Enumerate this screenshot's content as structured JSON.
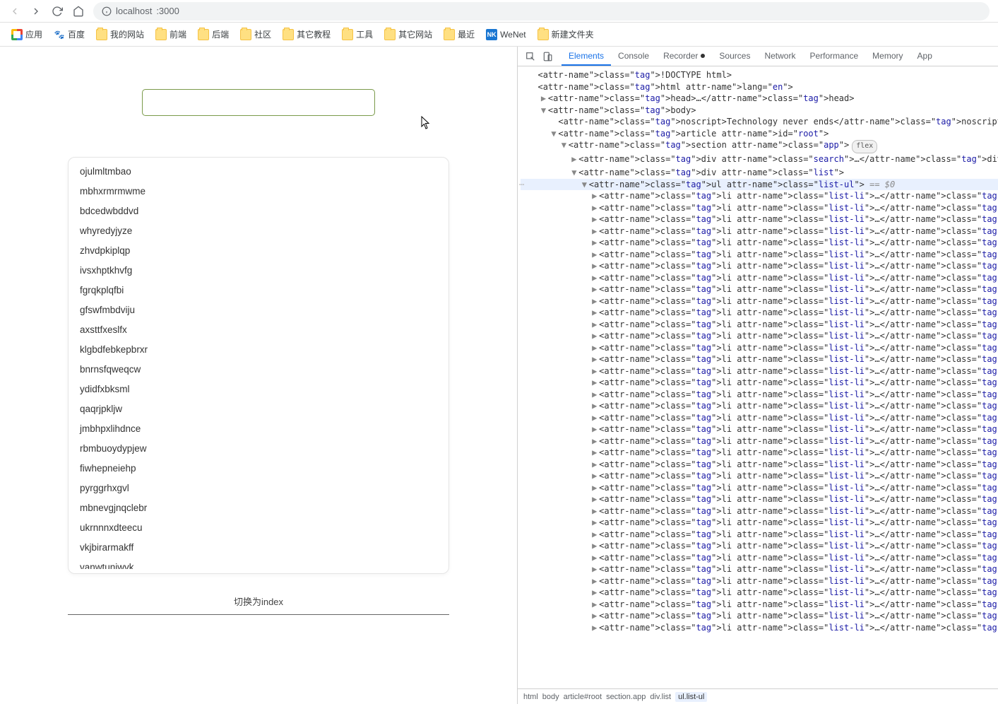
{
  "nav": {
    "url_prefix": "localhost",
    "url_suffix": ":3000"
  },
  "bookmarks": {
    "apps": "应用",
    "baidu": "百度",
    "items": [
      {
        "label": "我的网站"
      },
      {
        "label": "前端"
      },
      {
        "label": "后端"
      },
      {
        "label": "社区"
      },
      {
        "label": "其它教程"
      },
      {
        "label": "工具"
      },
      {
        "label": "其它网站"
      },
      {
        "label": "最近"
      }
    ],
    "wenet": "WeNet",
    "newfolder": "新建文件夹"
  },
  "app": {
    "search_value": "",
    "list": [
      "ojulmltmbao",
      "mbhxrmrmwme",
      "bdcedwbddvd",
      "whyredyjyze",
      "zhvdpkiplqp",
      "ivsxhptkhvfg",
      "fgrqkplqfbi",
      "gfswfmbdviju",
      "axsttfxeslfx",
      "klgbdfebkepbrxr",
      "bnrnsfqweqcw",
      "ydidfxbksml",
      "qaqrjpkljw",
      "jmbhpxlihdnce",
      "rbmbuoydypjew",
      "fiwhepneiehp",
      "pyrggrhxgvl",
      "mbnevgjnqclebr",
      "ukrnnnxdteecu",
      "vkjbirarmakff",
      "vanwtuniwvk"
    ],
    "toggle_label": "切换为index"
  },
  "devtools": {
    "tabs": [
      "Elements",
      "Console",
      "Recorder",
      "Sources",
      "Network",
      "Performance",
      "Memory",
      "App"
    ],
    "active_tab": 0,
    "doctype": "<!DOCTYPE html>",
    "html_open": "<html lang=\"en\">",
    "head": "<head>…</head>",
    "body_open": "<body>",
    "noscript": {
      "open": "<noscript>",
      "text": "Technology never ends",
      "close": "</noscript>"
    },
    "article_open": "<article id=\"root\">",
    "section_open": "<section class=\"app\">",
    "search_div": "<div class=\"search\">…</div>",
    "list_div_open": "<div class=\"list\">",
    "ul_open": "<ul class=\"list-ul\">",
    "ul_eq": " == $0",
    "li_line": "<li class=\"list-li\">…</li>",
    "li_count": 38,
    "flex_badge": "flex",
    "breadcrumb": [
      "html",
      "body",
      "article#root",
      "section.app",
      "div.list",
      "ul.list-ul"
    ]
  }
}
